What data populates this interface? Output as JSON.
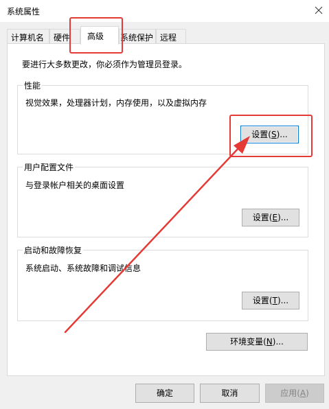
{
  "window": {
    "title": "系统属性",
    "close_icon": "close-icon"
  },
  "tabs": [
    {
      "label": "计算机名",
      "active": false
    },
    {
      "label": "硬件",
      "active": false
    },
    {
      "label": "高级",
      "active": true
    },
    {
      "label": "系统保护",
      "active": false
    },
    {
      "label": "远程",
      "active": false
    }
  ],
  "advanced": {
    "intro": "要进行大多数更改，你必须作为管理员登录。",
    "performance": {
      "title": "性能",
      "description": "视觉效果，处理器计划，内存使用，以及虚拟内存",
      "button_prefix": "设置(",
      "button_key": "S",
      "button_suffix": ")..."
    },
    "user_profiles": {
      "title": "用户配置文件",
      "description": "与登录帐户相关的桌面设置",
      "button_prefix": "设置(",
      "button_key": "E",
      "button_suffix": ")..."
    },
    "startup_recovery": {
      "title": "启动和故障恢复",
      "description": "系统启动、系统故障和调试信息",
      "button_prefix": "设置(",
      "button_key": "T",
      "button_suffix": ")..."
    },
    "env_vars": {
      "button_prefix": "环境变量(",
      "button_key": "N",
      "button_suffix": ")..."
    }
  },
  "footer": {
    "ok_label": "确定",
    "cancel_label": "取消",
    "apply_prefix": "应用(",
    "apply_key": "A",
    "apply_suffix": ")",
    "apply_enabled": false
  },
  "annotations": {
    "highlight_color": "#e53935",
    "arrow_color": "#e53935"
  }
}
